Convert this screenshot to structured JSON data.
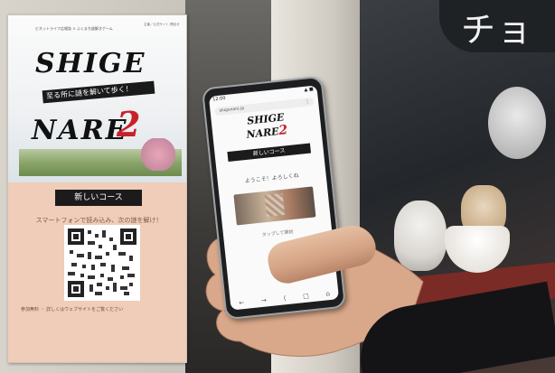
{
  "poster": {
    "header": "ビネットライフ広報誌 × ふくまち謎解きゲーム",
    "corner": "主催／公式サイト 問合せ",
    "logo_shige": "SHIGE",
    "logo_sub": "至る所に謎を解いて歩く！",
    "logo_nare": "NARE",
    "logo_number": "2",
    "course": "新しいコース",
    "course_line": "スマートフォンで読み込み、次の謎を解け！",
    "footer": "参加無料 ・ 詳しくはウェブサイトをご覧ください"
  },
  "phone": {
    "status_time": "12:00",
    "status_icons": "▲ ■",
    "url": "shigenare.jp",
    "menu": "⋮",
    "logo_line1": "SHIGE",
    "logo_line2": "NARE",
    "logo_number": "2",
    "band": "新しいコース",
    "message": "ようこそ！よろしくね",
    "caption": "タップして開始",
    "nav": [
      "←",
      "→",
      "⟨",
      "□",
      "⌂"
    ]
  },
  "shop": {
    "sign": "チョ"
  }
}
